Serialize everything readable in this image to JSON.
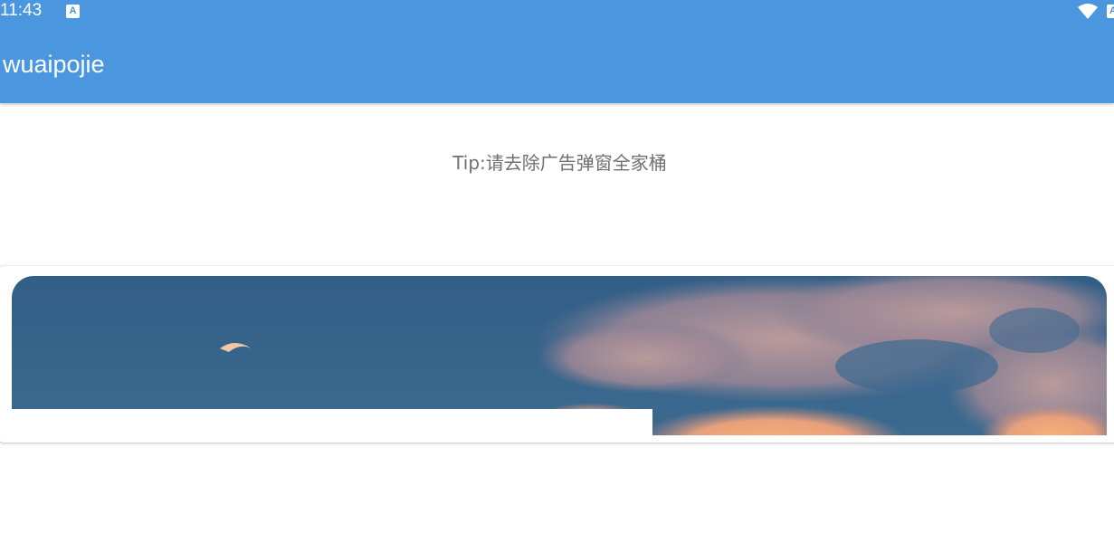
{
  "status_bar": {
    "time": "11:43",
    "notification_icon": "a-letter-icon",
    "wifi_icon": "wifi-icon",
    "right_icon": "a-letter-icon",
    "icon_letter": "A"
  },
  "toolbar": {
    "title": "wuaipojie"
  },
  "main": {
    "tip": "Tip:请去除广告弹窗全家桶",
    "banner": {
      "description_icon": "sky-clouds-moon-image"
    }
  },
  "colors": {
    "primary": "#4a97e0",
    "background": "#ffffff",
    "tip_text": "#6f6f6f"
  }
}
